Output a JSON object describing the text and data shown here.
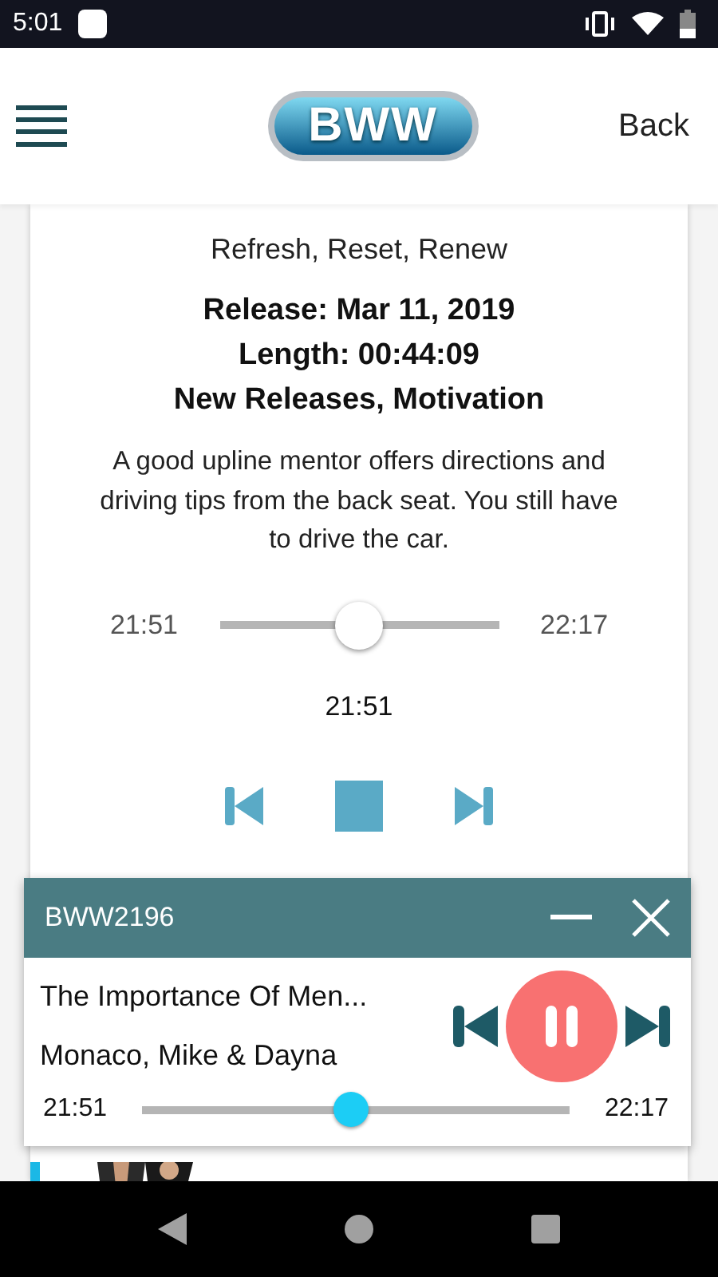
{
  "status_bar": {
    "time": "5:01"
  },
  "header": {
    "logo": "BWW",
    "back": "Back"
  },
  "episode": {
    "subtitle": "Refresh, Reset, Renew",
    "release": "Release: Mar 11, 2019",
    "length": "Length: 00:44:09",
    "categories": "New Releases, Motivation",
    "description": "A good upline mentor offers directions and driving tips from the back seat. You still have to drive the car.",
    "elapsed": "21:51",
    "remaining": "22:17",
    "level": 0.5,
    "current_time": "21:51"
  },
  "mini_player": {
    "code": "BWW2196",
    "title": "The Importance Of Men...",
    "author": "Monaco, Mike & Dayna",
    "playing": true,
    "elapsed": "21:51",
    "remaining": "22:17",
    "level": 0.49
  }
}
